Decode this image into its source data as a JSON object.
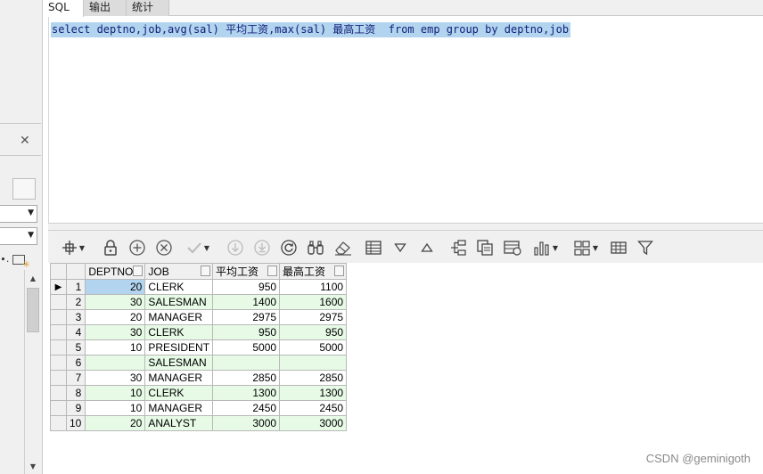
{
  "tabs": [
    {
      "label": "SQL"
    },
    {
      "label": "输出"
    },
    {
      "label": "统计"
    }
  ],
  "editor": {
    "sql": "select deptno,job,avg(sal) 平均工资,max(sal) 最高工资  from emp group by deptno,job"
  },
  "left_pane": {
    "close": "✕"
  },
  "toolbar": {
    "icons": [
      "wand-icon",
      "lock-icon",
      "add-record-icon",
      "delete-record-icon",
      "post-edit-icon",
      "cancel-edit-icon",
      "fetch-next-icon",
      "fetch-last-icon",
      "refresh-icon",
      "query-by-example-icon",
      "clear-filter-icon",
      "single-record-view-icon",
      "sort-descending-icon",
      "sort-ascending-icon",
      "export-icon",
      "copy-icon",
      "print-icon",
      "chart-icon",
      "layout-icon",
      "grid-view-icon",
      "filter-icon"
    ]
  },
  "grid": {
    "columns": [
      "DEPTNO",
      "JOB",
      "平均工资",
      "最高工资"
    ],
    "rows": [
      {
        "n": "1",
        "deptno": "20",
        "job": "CLERK",
        "avg": "950",
        "max": "1100"
      },
      {
        "n": "2",
        "deptno": "30",
        "job": "SALESMAN",
        "avg": "1400",
        "max": "1600"
      },
      {
        "n": "3",
        "deptno": "20",
        "job": "MANAGER",
        "avg": "2975",
        "max": "2975"
      },
      {
        "n": "4",
        "deptno": "30",
        "job": "CLERK",
        "avg": "950",
        "max": "950"
      },
      {
        "n": "5",
        "deptno": "10",
        "job": "PRESIDENT",
        "avg": "5000",
        "max": "5000"
      },
      {
        "n": "6",
        "deptno": "",
        "job": "SALESMAN",
        "avg": "",
        "max": ""
      },
      {
        "n": "7",
        "deptno": "30",
        "job": "MANAGER",
        "avg": "2850",
        "max": "2850"
      },
      {
        "n": "8",
        "deptno": "10",
        "job": "CLERK",
        "avg": "1300",
        "max": "1300"
      },
      {
        "n": "9",
        "deptno": "10",
        "job": "MANAGER",
        "avg": "2450",
        "max": "2450"
      },
      {
        "n": "10",
        "deptno": "20",
        "job": "ANALYST",
        "avg": "3000",
        "max": "3000"
      }
    ]
  },
  "watermark": "CSDN @geminigoth",
  "colors": {
    "selection": "#b3d4ee",
    "row_alt": "#e6fae6",
    "sql_text": "#10207a"
  }
}
